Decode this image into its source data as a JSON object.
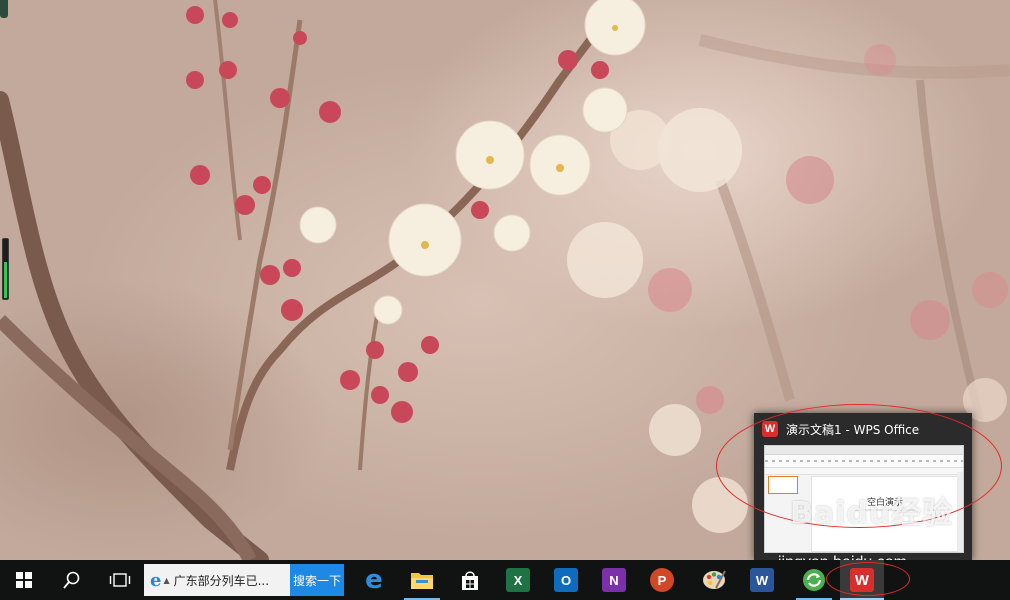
{
  "preview": {
    "title": "演示文稿1 - WPS Office",
    "app_glyph": "W",
    "thumbnail": {
      "canvas_text": "空白演示"
    }
  },
  "watermark": {
    "text": "Baidu经验",
    "url": "jingyan.baidu.com"
  },
  "taskbar": {
    "search_text": "广东部分列车已...",
    "search_button": "搜索一下",
    "apps": [
      {
        "name": "edge",
        "glyph": "e"
      },
      {
        "name": "file-explorer"
      },
      {
        "name": "store"
      },
      {
        "name": "excel",
        "glyph": "X"
      },
      {
        "name": "outlook",
        "glyph": "O"
      },
      {
        "name": "onenote",
        "glyph": "N"
      },
      {
        "name": "powerpoint",
        "glyph": "P"
      },
      {
        "name": "paint"
      },
      {
        "name": "word",
        "glyph": "W"
      },
      {
        "name": "green-app"
      },
      {
        "name": "wps-office",
        "glyph": "W"
      }
    ]
  },
  "colors": {
    "taskbar": "#111313",
    "accent": "#1e88e5",
    "annotation_red": "#e22a2a",
    "excel": "#1f7244",
    "outlook": "#0f6cbd",
    "onenote": "#7b2fa8",
    "powerpoint": "#d24726",
    "word": "#2b579a",
    "wps": "#d92e2e"
  }
}
